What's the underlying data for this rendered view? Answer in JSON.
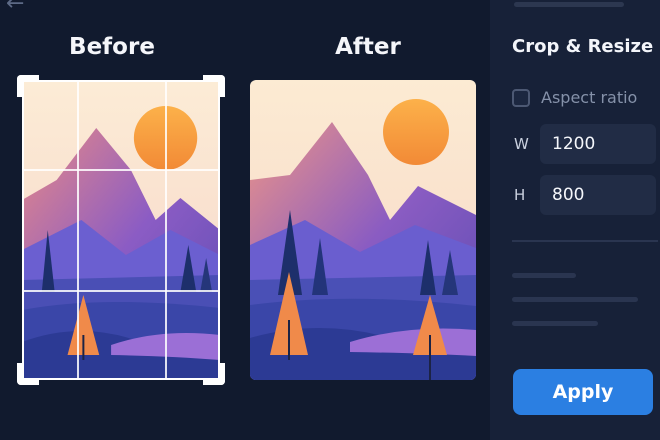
{
  "nav": {
    "back_icon": "arrow-left-icon"
  },
  "comparison": {
    "before_title": "Before",
    "after_title": "After"
  },
  "panel": {
    "title": "Crop & Resize",
    "aspect_ratio_label": "Aspect ratio",
    "aspect_ratio_checked": false,
    "width_label": "W",
    "width_value": "1200",
    "height_label": "H",
    "height_value": "800",
    "apply_label": "Apply"
  },
  "colors": {
    "background": "#111a2e",
    "panel": "#172138",
    "accent": "#2b7fe2",
    "sun": "#f59a3c",
    "sky": "#fbe6c9"
  }
}
